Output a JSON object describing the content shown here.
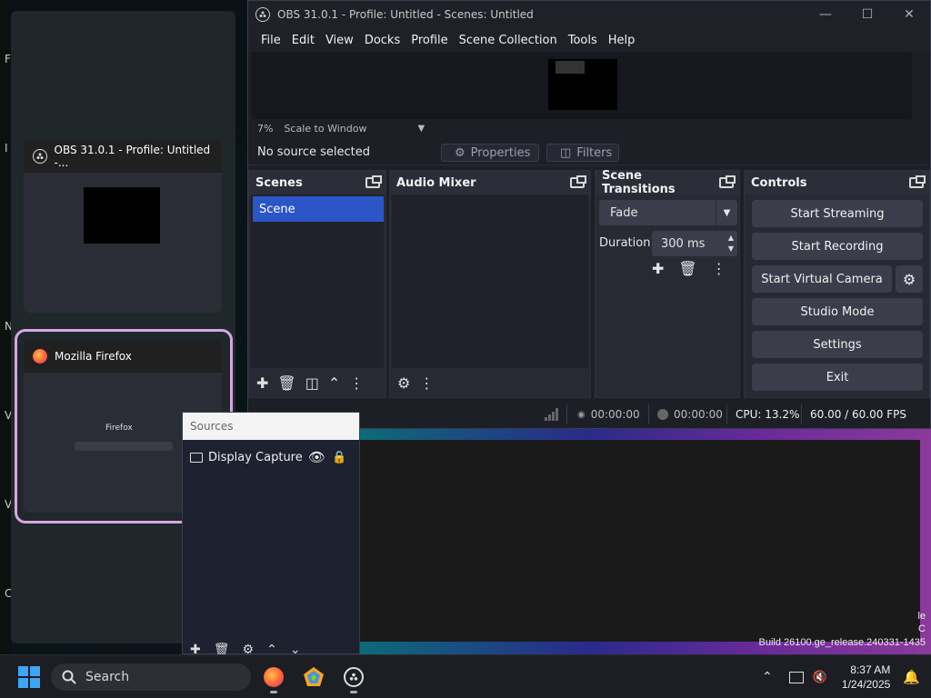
{
  "colors": {
    "accent_scene": "#2c55c7",
    "switcher_highlight": "#d6a6e0",
    "windows_blue": "#3ea6f5"
  },
  "desktop": {
    "edge_letters": [
      "F",
      "I",
      "N",
      "V",
      "V",
      "Cl"
    ],
    "build_lines": [
      "le",
      "C",
      "Build 26100.ge_release.240331-1435"
    ]
  },
  "switcher": {
    "cards": [
      {
        "title": "OBS 31.0.1 - Profile: Untitled -...",
        "icon": "obs-icon"
      },
      {
        "title": "Mozilla Firefox",
        "icon": "firefox-icon",
        "thumb_text": "Firefox"
      }
    ]
  },
  "obs": {
    "title": "OBS 31.0.1 - Profile: Untitled - Scenes: Untitled",
    "menu": [
      "File",
      "Edit",
      "View",
      "Docks",
      "Profile",
      "Scene Collection",
      "Tools",
      "Help"
    ],
    "scale": {
      "percent": "7%",
      "mode": "Scale to Window"
    },
    "source_status": "No source selected",
    "properties_label": "Properties",
    "filters_label": "Filters",
    "docks": {
      "scenes": {
        "title": "Scenes",
        "items": [
          "Scene"
        ]
      },
      "audio_mixer": {
        "title": "Audio Mixer"
      },
      "transitions": {
        "title": "Scene Transitions",
        "selected": "Fade",
        "duration_label": "Duration",
        "duration_value": "300 ms"
      },
      "controls": {
        "title": "Controls",
        "buttons": [
          "Start Streaming",
          "Start Recording",
          "Start Virtual Camera",
          "Studio Mode",
          "Settings",
          "Exit"
        ]
      }
    },
    "status": {
      "stream_time": "00:00:00",
      "record_time": "00:00:00",
      "cpu": "CPU: 13.2%",
      "fps": "60.00 / 60.00 FPS"
    }
  },
  "sources": {
    "title": "Sources",
    "items": [
      {
        "label": "Display Capture"
      }
    ]
  },
  "taskbar": {
    "search_label": "Search",
    "time": "8:37 AM",
    "date": "1/24/2025"
  }
}
